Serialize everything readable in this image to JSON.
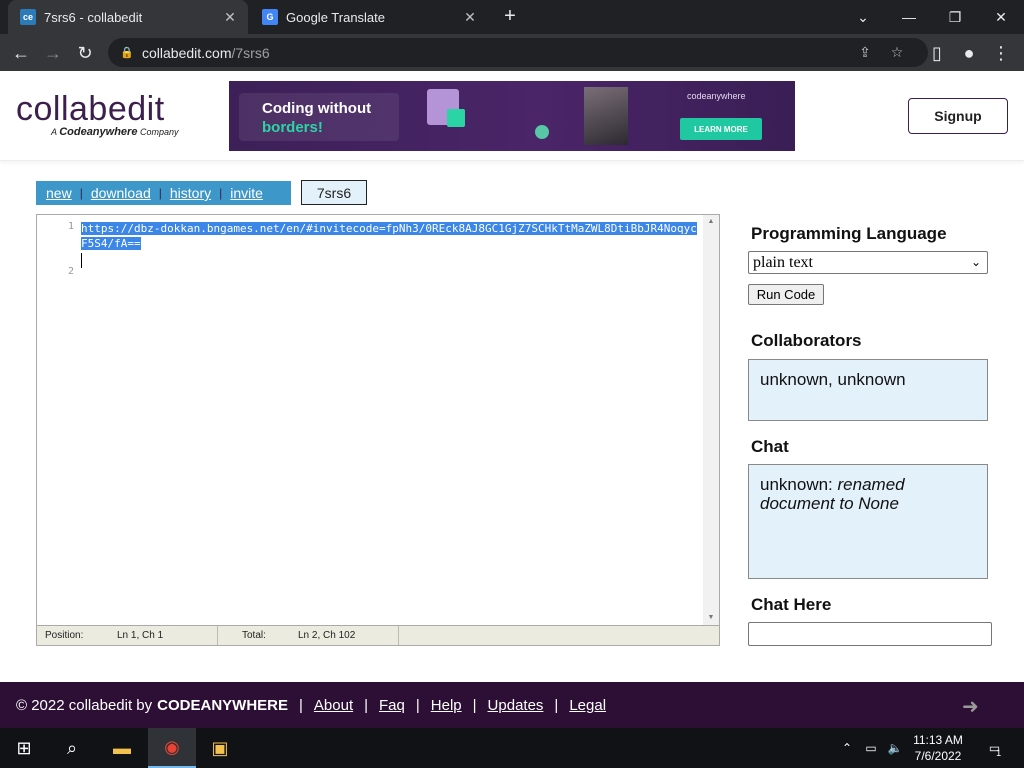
{
  "browser": {
    "tabs": [
      {
        "title": "7srs6 - collabedit",
        "favicon": "ce"
      },
      {
        "title": "Google Translate",
        "favicon": "G"
      }
    ],
    "address": {
      "host": "collabedit.com",
      "path": "/7srs6"
    }
  },
  "header": {
    "logo_word": "collabedit",
    "logo_sub_prefix": "A",
    "logo_sub_brand": "Codeanywhere",
    "logo_sub_suffix": "Company",
    "banner": {
      "line1": "Coding without",
      "line2": "borders!",
      "brand": "codeanywhere",
      "cta": "LEARN MORE"
    },
    "signup_label": "Signup"
  },
  "toolbar": {
    "links": [
      "new",
      "download",
      "history",
      "invite"
    ],
    "sep": "|",
    "doc_id": "7srs6"
  },
  "editor": {
    "line_numbers": [
      "1",
      "2"
    ],
    "code": "https://dbz-dokkan.bngames.net/en/#invitecode=fpNh3/0REck8AJ8GC1GjZ7SCHkTtMaZWL8DtiBbJR4NoqycF5S4/fA==",
    "status": {
      "position_label": "Position:",
      "position_value": "Ln 1, Ch 1",
      "total_label": "Total:",
      "total_value": "Ln 2, Ch 102"
    }
  },
  "sidebar": {
    "lang_heading": "Programming Language",
    "lang_selected": "plain text",
    "run_label": "Run Code",
    "collab_heading": "Collaborators",
    "collaborators": "unknown, unknown",
    "chat_heading": "Chat",
    "chat_user": "unknown:",
    "chat_msg": "renamed document to None",
    "chat_here_heading": "Chat Here"
  },
  "footer": {
    "copy": "© 2022 collabedit by",
    "brand": "CODEANYWHERE",
    "links": [
      "About",
      "Faq",
      "Help",
      "Updates",
      "Legal"
    ],
    "sep": "|"
  },
  "taskbar": {
    "time": "11:13 AM",
    "date": "7/6/2022",
    "notifications": "1"
  },
  "colors": {
    "toolbar_blue": "#3d97c9",
    "footer_purple": "#2d0f36",
    "box_bg": "#e3f1fa",
    "selection": "#3b86e6"
  }
}
